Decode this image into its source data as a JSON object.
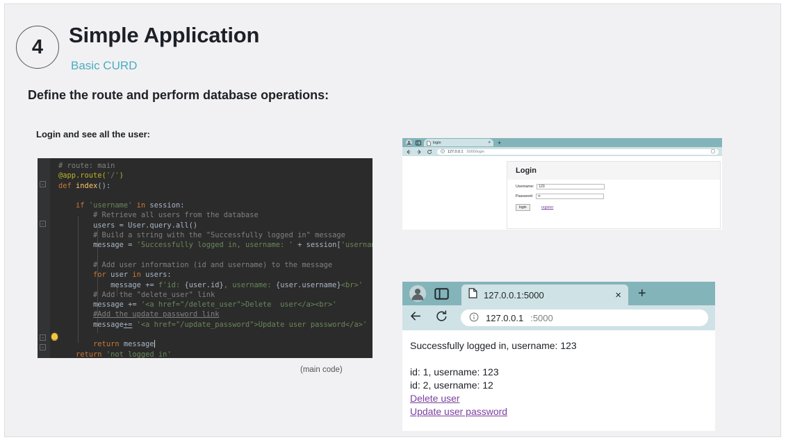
{
  "slide": {
    "number": "4",
    "title": "Simple Application",
    "subtitle": "Basic CURD",
    "section_heading": "Define the route and perform database operations:",
    "sub_label": "Login and see all the user:",
    "code_caption": "(main code)",
    "accent_color": "#4aadc0",
    "background_color": "#f1f1f3"
  },
  "code": {
    "language": "python",
    "background_color": "#2b2b2b",
    "lines": [
      "# route: main",
      "@app.route('/')",
      "def index():",
      "",
      "    if 'username' in session:",
      "        # Retrieve all users from the database",
      "        users = User.query.all()",
      "        # Build a string with the \"Successfully logged in\" message",
      "        message = 'Successfully logged in, username: ' + session['username'] + '<br>'+'<br>'",
      "",
      "        # Add user information (id and username) to the message",
      "        for user in users:",
      "            message += f'id: {user.id}, username: {user.username}<br>'",
      "        # Add the \"delete_user\" link",
      "        message += '<a href=\"/delete_user\">Delete  user</a><br>'",
      "        #Add the update password link",
      "        message+= '<a href=\"/update_password\">Update user password</a>'",
      "",
      "        return message",
      "    return 'not logged in'"
    ]
  },
  "browser_small": {
    "tab_title": "login",
    "new_tab_label": "+",
    "close_label": "×",
    "back_icon": "arrow-left-icon",
    "forward_icon": "arrow-right-icon",
    "reload_icon": "reload-icon",
    "info_icon": "info-icon",
    "url_host": "127.0.0.1",
    "url_rest": ":5000/login",
    "page": {
      "card_title": "Login",
      "username_label": "Username:",
      "username_value": "123",
      "password_label": "Password:",
      "password_value": "••",
      "submit_label": "login",
      "register_link": "register"
    }
  },
  "browser_big": {
    "profile_icon": "profile-avatar-icon",
    "collections_icon": "panel-icon",
    "tab_favicon": "page-icon",
    "tab_title": "127.0.0.1:5000",
    "close_label": "×",
    "new_tab_label": "+",
    "back_icon": "arrow-left-icon",
    "reload_icon": "reload-icon",
    "info_icon": "info-icon",
    "url_host": "127.0.0.1",
    "url_port": ":5000",
    "page": {
      "status_message": "Successfully logged in, username: 123",
      "user_rows": [
        "id: 1, username: 123",
        "id: 2, username: 12"
      ],
      "links": [
        "Delete user",
        "Update user password"
      ]
    }
  }
}
